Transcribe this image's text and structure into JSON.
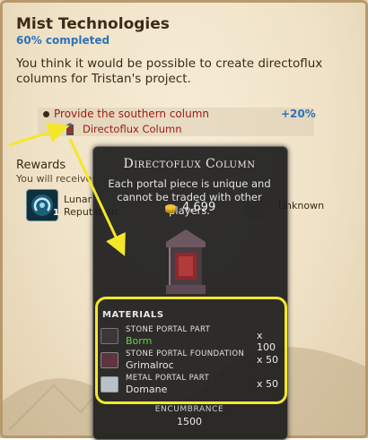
{
  "quest": {
    "title": "Mist Technologies",
    "progress": "60% completed",
    "description": "You think it would be possible to create directoflux columns for Tristan's project."
  },
  "objective": {
    "text": "Provide the southern column",
    "reward_percent": "+20%",
    "item": "Directoflux Column"
  },
  "rewards": {
    "heading": "Rewards",
    "subheading": "You will receive:",
    "items": [
      {
        "name": "Lunar",
        "type": "Reputation",
        "count": "1",
        "icon": "lunar-reputation-icon"
      },
      {
        "name": "Unknown",
        "icon": "unknown-reward-icon"
      }
    ]
  },
  "tooltip": {
    "title": "Directoflux Column",
    "description": "Each portal piece is unique and cannot be traded with other players.",
    "gold": "4,699",
    "materials_header": "MATERIALS",
    "materials": [
      {
        "type": "Stone Portal Part",
        "name": "Borm",
        "quantity": "x 100",
        "name_color": "#6fd13c",
        "icon": "stone-portal-part-icon"
      },
      {
        "type": "Stone portal foundation",
        "name": "Grimalroc",
        "quantity": "x 50",
        "name_color": "#e6e6e6",
        "icon": "stone-portal-foundation-icon"
      },
      {
        "type": "Metal Portal Part",
        "name": "Domane",
        "quantity": "x 50",
        "name_color": "#e6e6e6",
        "icon": "metal-portal-part-icon"
      }
    ],
    "encumbrance_label": "ENCUMBRANCE",
    "encumbrance_value": "1500"
  },
  "colors": {
    "accent_blue": "#2f72b8",
    "objective_red": "#9b1b16",
    "highlight_yellow": "#f4e72a",
    "common_green": "#6fd13c"
  }
}
